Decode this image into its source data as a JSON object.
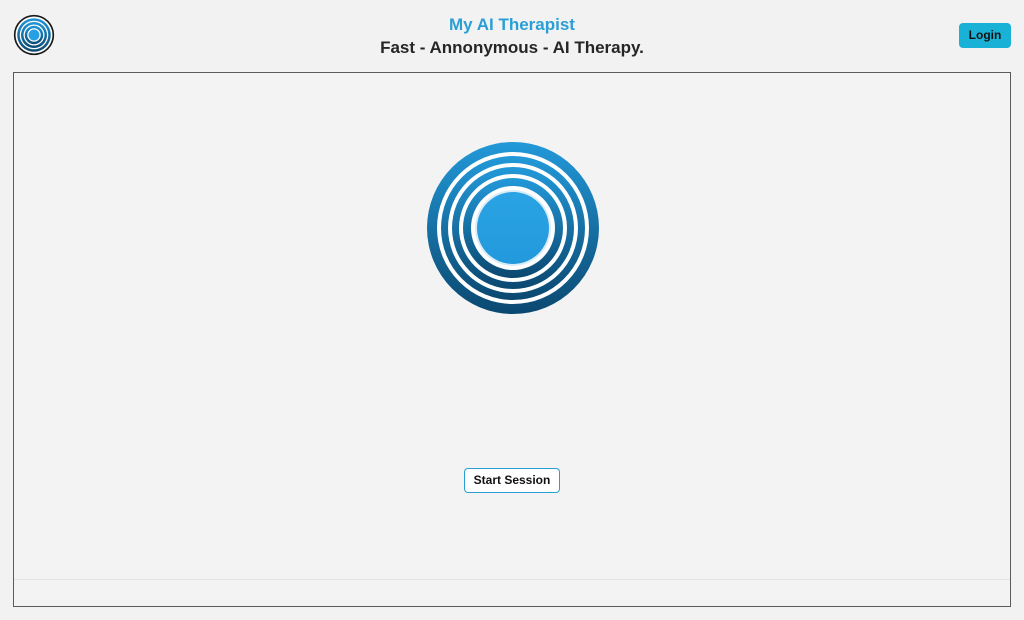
{
  "header": {
    "logo_icon": "concentric-rings-logo-icon",
    "app_title": "My AI Therapist",
    "tagline": "Fast - Annonymous - AI Therapy.",
    "login_label": "Login"
  },
  "main": {
    "hero_icon": "concentric-rings-logo-icon",
    "start_label": "Start Session"
  },
  "colors": {
    "brand_blue": "#2a9fd6",
    "login_button": "#19b2d6",
    "logo_gradient_top": "#2196d8",
    "logo_gradient_bottom": "#0b4a73",
    "panel_border": "#5a5a5a",
    "background": "#f2f2f2"
  }
}
